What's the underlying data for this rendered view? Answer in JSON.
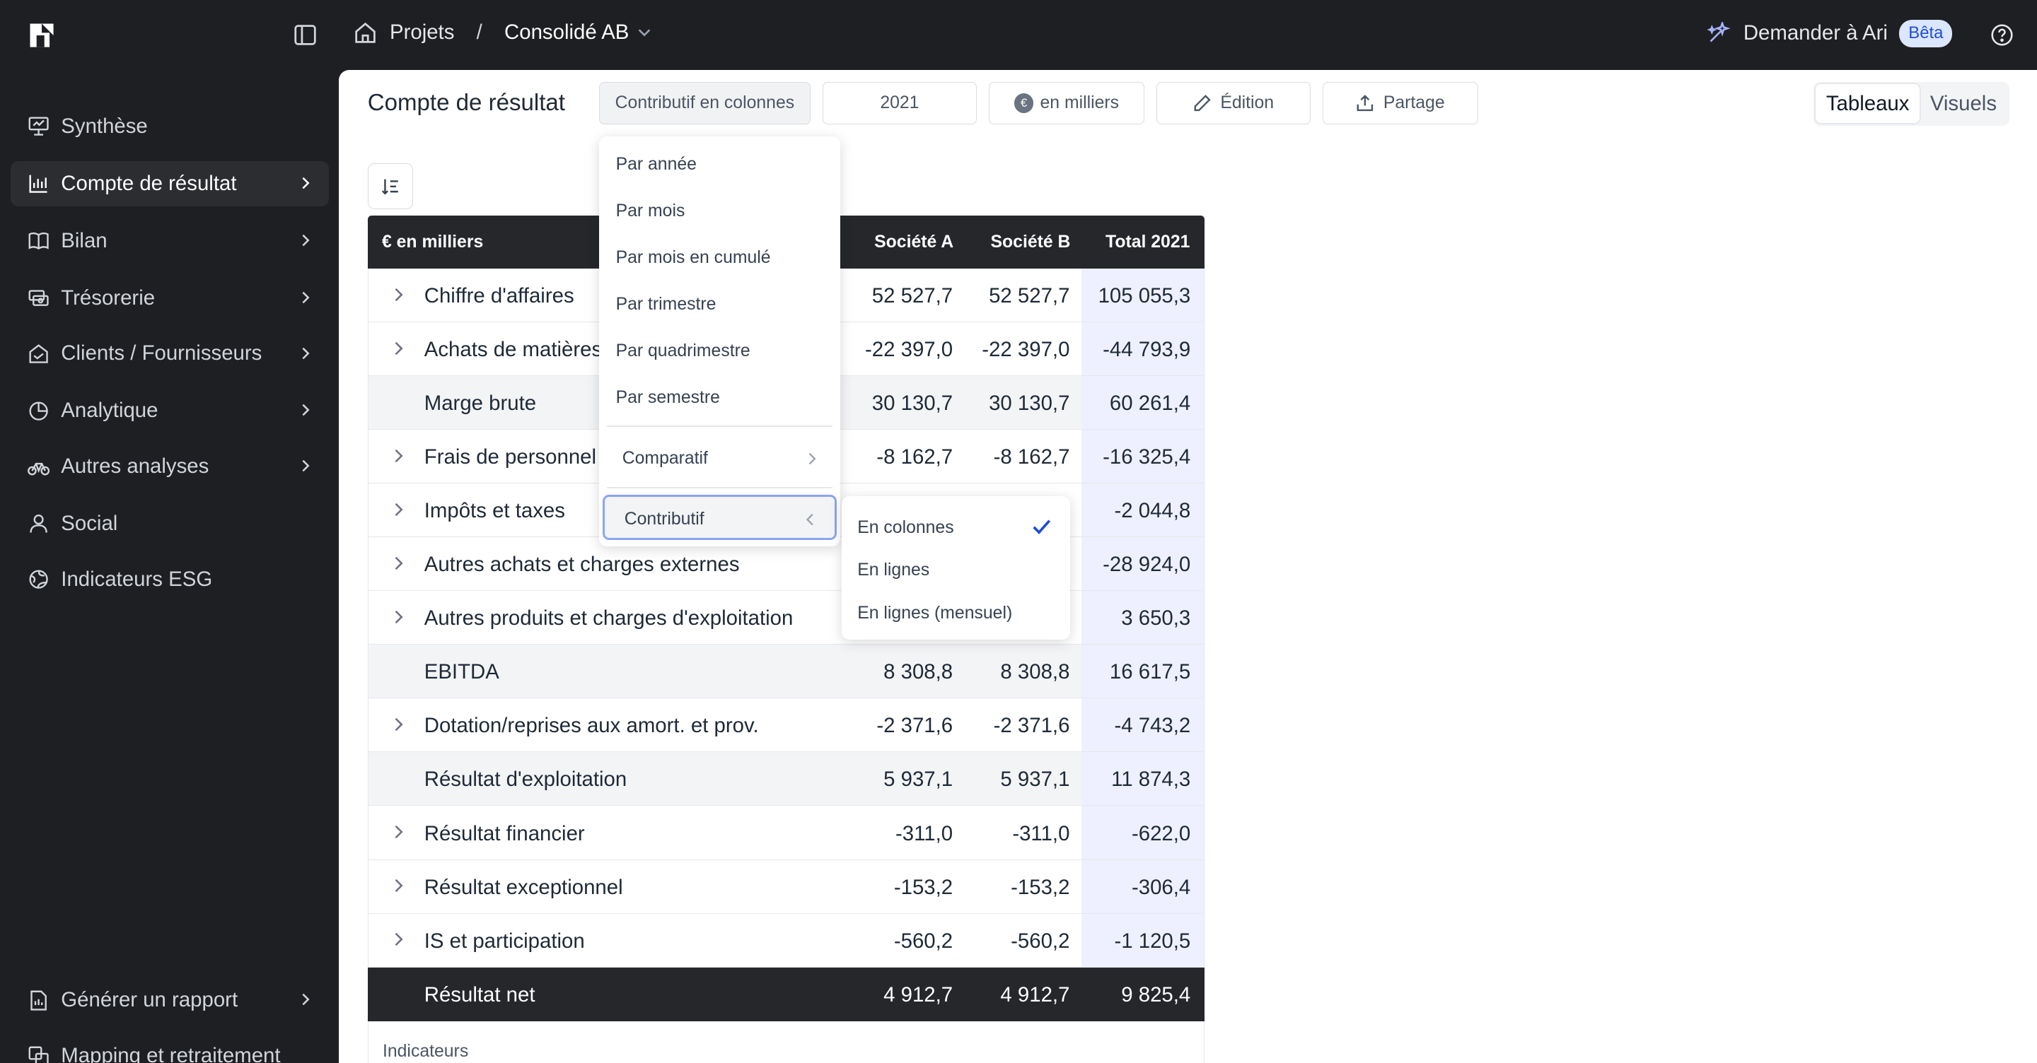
{
  "topbar": {
    "breadcrumb_projects": "Projets",
    "breadcrumb_sep": "/",
    "breadcrumb_current": "Consolidé AB",
    "ask_label": "Demander à Ari",
    "beta_badge": "Bêta"
  },
  "sidebar": {
    "items": [
      {
        "label": "Synthèse",
        "icon": "presentation-icon"
      },
      {
        "label": "Compte de résultat",
        "icon": "bar-chart-icon",
        "active": true
      },
      {
        "label": "Bilan",
        "icon": "book-icon"
      },
      {
        "label": "Trésorerie",
        "icon": "cash-icon"
      },
      {
        "label": "Clients / Fournisseurs",
        "icon": "handshake-icon"
      },
      {
        "label": "Analytique",
        "icon": "pie-icon"
      },
      {
        "label": "Autres analyses",
        "icon": "bike-icon"
      },
      {
        "label": "Social",
        "icon": "user-icon"
      },
      {
        "label": "Indicateurs ESG",
        "icon": "globe-icon"
      }
    ],
    "bottom": [
      {
        "label": "Générer un rapport",
        "icon": "report-icon"
      },
      {
        "label": "Mapping et retraitement",
        "icon": "mapping-icon"
      }
    ]
  },
  "toolbar": {
    "title": "Compte de résultat",
    "view_mode": "Contributif en colonnes",
    "year": "2021",
    "unit_symbol": "€",
    "unit": "en milliers",
    "edit": "Édition",
    "share": "Partage",
    "tab_tables": "Tableaux",
    "tab_visuals": "Visuels"
  },
  "table": {
    "headers": [
      "€ en milliers",
      "Société A",
      "Société B",
      "Total 2021"
    ],
    "rows": [
      {
        "label": "Chiffre d'affaires",
        "a": "52 527,7",
        "b": "52 527,7",
        "t": "105 055,3",
        "type": "expandable"
      },
      {
        "label": "Achats de matières",
        "a": "-22 397,0",
        "b": "-22 397,0",
        "t": "-44 793,9",
        "type": "expandable"
      },
      {
        "label": "Marge brute",
        "a": "30 130,7",
        "b": "30 130,7",
        "t": "60 261,4",
        "type": "subtotal"
      },
      {
        "label": "Frais de personnel",
        "a": "-8 162,7",
        "b": "-8 162,7",
        "t": "-16 325,4",
        "type": "expandable"
      },
      {
        "label": "Impôts et taxes",
        "a": "",
        "b": "",
        "t": "-2 044,8",
        "type": "expandable"
      },
      {
        "label": "Autres achats et charges externes",
        "a": "",
        "b": "",
        "t": "-28 924,0",
        "type": "expandable"
      },
      {
        "label": "Autres produits et charges d'exploitation",
        "a": "",
        "b": "",
        "t": "3 650,3",
        "type": "expandable"
      },
      {
        "label": "EBITDA",
        "a": "8 308,8",
        "b": "8 308,8",
        "t": "16 617,5",
        "type": "subtotal"
      },
      {
        "label": "Dotation/reprises aux amort. et prov.",
        "a": "-2 371,6",
        "b": "-2 371,6",
        "t": "-4 743,2",
        "type": "expandable"
      },
      {
        "label": "Résultat d'exploitation",
        "a": "5 937,1",
        "b": "5 937,1",
        "t": "11 874,3",
        "type": "subtotal"
      },
      {
        "label": "Résultat financier",
        "a": "-311,0",
        "b": "-311,0",
        "t": "-622,0",
        "type": "expandable"
      },
      {
        "label": "Résultat exceptionnel",
        "a": "-153,2",
        "b": "-153,2",
        "t": "-306,4",
        "type": "expandable"
      },
      {
        "label": "IS et participation",
        "a": "-560,2",
        "b": "-560,2",
        "t": "-1 120,5",
        "type": "expandable"
      },
      {
        "label": "Résultat net",
        "a": "4 912,7",
        "b": "4 912,7",
        "t": "9 825,4",
        "type": "net"
      }
    ],
    "indicators_label": "Indicateurs"
  },
  "menu": {
    "items": [
      "Par année",
      "Par mois",
      "Par mois en cumulé",
      "Par trimestre",
      "Par quadrimestre",
      "Par semestre"
    ],
    "comparatif": "Comparatif",
    "contributif": "Contributif",
    "submenu": [
      "En colonnes",
      "En lignes",
      "En lignes (mensuel)"
    ],
    "selected": "En colonnes"
  }
}
